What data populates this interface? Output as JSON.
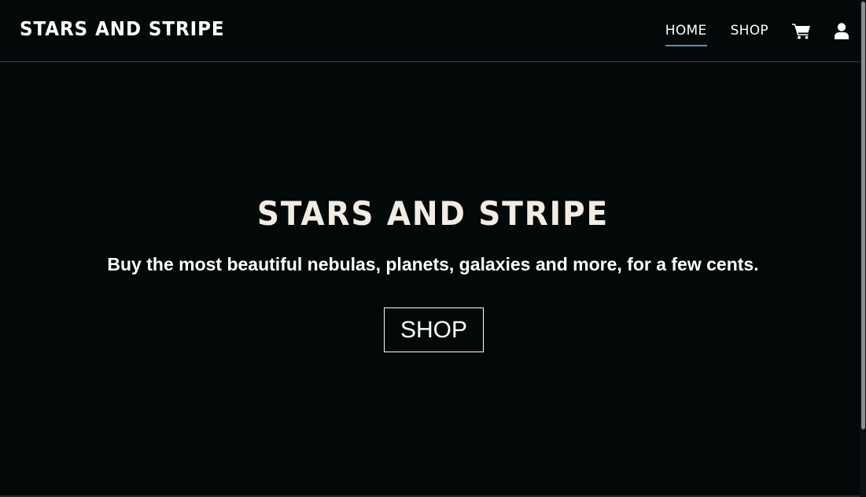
{
  "navbar": {
    "brand": "STARS AND STRIPE",
    "links": [
      {
        "label": "HOME",
        "active": true
      },
      {
        "label": "SHOP",
        "active": false
      }
    ],
    "icons": [
      "cart-icon",
      "user-icon"
    ],
    "underline_color": "#5a8fb8",
    "border_color": "#2f4a5a"
  },
  "hero": {
    "title": "STARS AND STRIPE",
    "subtitle": "Buy the most beautiful nebulas, planets, galaxies and more, for a few cents.",
    "button_label": "SHOP"
  },
  "colors": {
    "background": "#030808",
    "text": "#ffffff",
    "title": "#f3ece4"
  }
}
